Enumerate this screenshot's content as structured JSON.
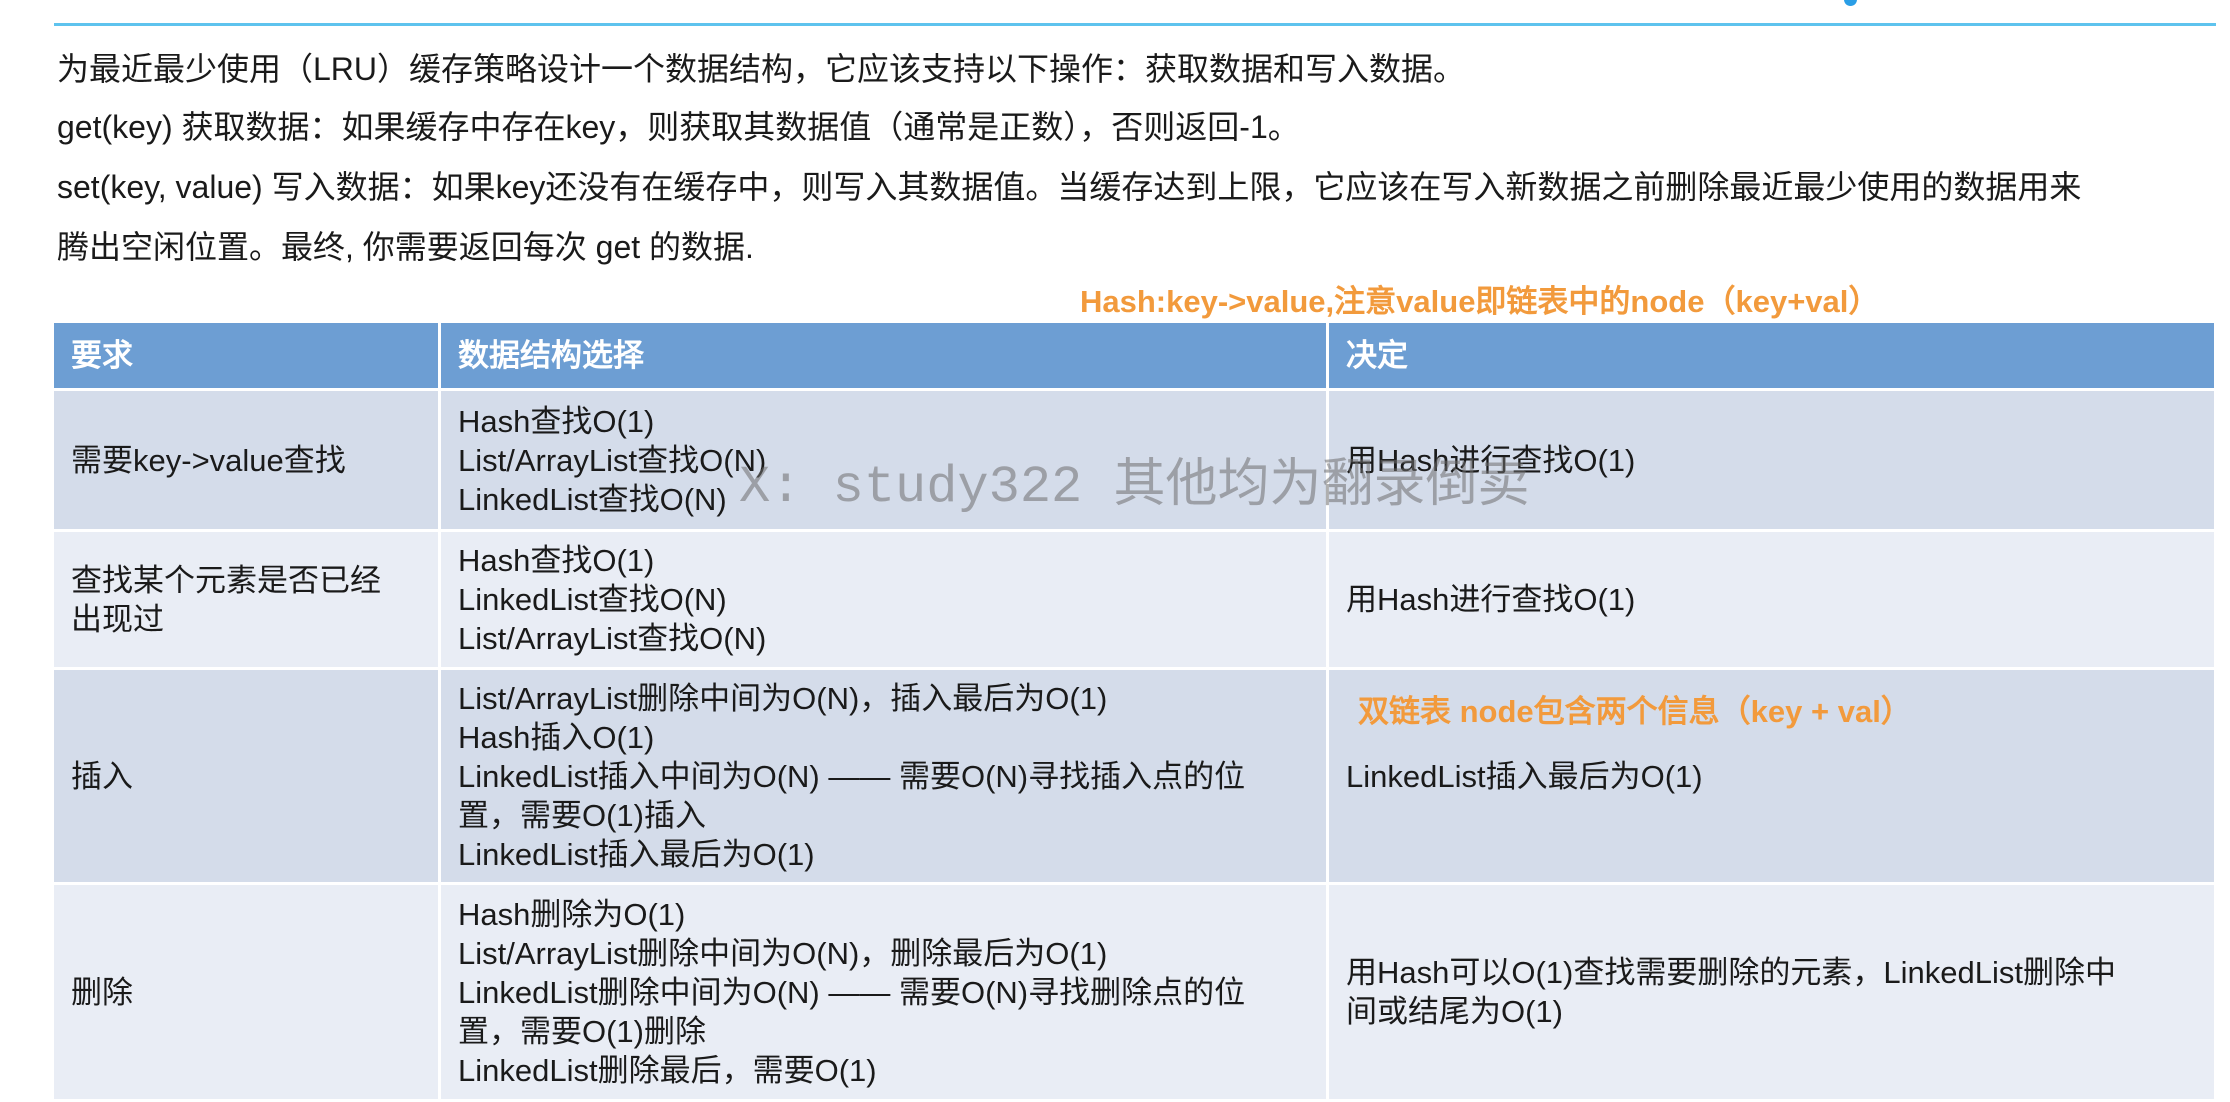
{
  "colors": {
    "accent_line": "#5ec3ee",
    "accent_dot": "#2a9ee6",
    "header_bg": "#6d9ed3",
    "row_dark": "#d4dcea",
    "row_light": "#e9edf5",
    "highlight_text": "#f29a3c",
    "body_text": "#1a1a1a",
    "watermark": "rgba(110,110,110,0.55)"
  },
  "intro": {
    "lines": [
      "为最近最少使用（LRU）缓存策略设计一个数据结构，它应该支持以下操作：获取数据和写入数据。",
      "get(key) 获取数据：如果缓存中存在key，则获取其数据值（通常是正数），否则返回-1。",
      "set(key, value) 写入数据：如果key还没有在缓存中，则写入其数据值。当缓存达到上限，它应该在写入新数据之前删除最近最少使用的数据用来",
      "腾出空闲位置。最终, 你需要返回每次 get 的数据."
    ]
  },
  "annotation": "Hash:key->value,注意value即链表中的node（key+val）",
  "table": {
    "headers": [
      "要求",
      "数据结构选择",
      "决定"
    ],
    "rows": [
      {
        "requirement": [
          "需要key->value查找"
        ],
        "options": [
          "Hash查找O(1)",
          "List/ArrayList查找O(N)",
          "LinkedList查找O(N)"
        ],
        "decision": [
          "用Hash进行查找O(1)"
        ]
      },
      {
        "requirement": [
          "查找某个元素是否已经",
          "出现过"
        ],
        "options": [
          "Hash查找O(1)",
          "LinkedList查找O(N)",
          "List/ArrayList查找O(N)"
        ],
        "decision": [
          "用Hash进行查找O(1)"
        ]
      },
      {
        "requirement": [
          "插入"
        ],
        "options": [
          "List/ArrayList删除中间为O(N)，插入最后为O(1)",
          "Hash插入O(1)",
          "LinkedList插入中间为O(N) —— 需要O(N)寻找插入点的位",
          "置，需要O(1)插入",
          "LinkedList插入最后为O(1)"
        ],
        "decision_note": "双链表 node包含两个信息（key + val）",
        "decision": [
          "LinkedList插入最后为O(1)"
        ]
      },
      {
        "requirement": [
          "删除"
        ],
        "options": [
          "Hash删除为O(1)",
          "List/ArrayList删除中间为O(N)，删除最后为O(1)",
          "LinkedList删除中间为O(N) —— 需要O(N)寻找删除点的位",
          "置，需要O(1)删除",
          "LinkedList删除最后，需要O(1)"
        ],
        "decision": [
          "用Hash可以O(1)查找需要删除的元素，LinkedList删除中",
          "间或结尾为O(1)"
        ]
      }
    ]
  },
  "watermark": "X: study322 其他均为翻录倒卖"
}
